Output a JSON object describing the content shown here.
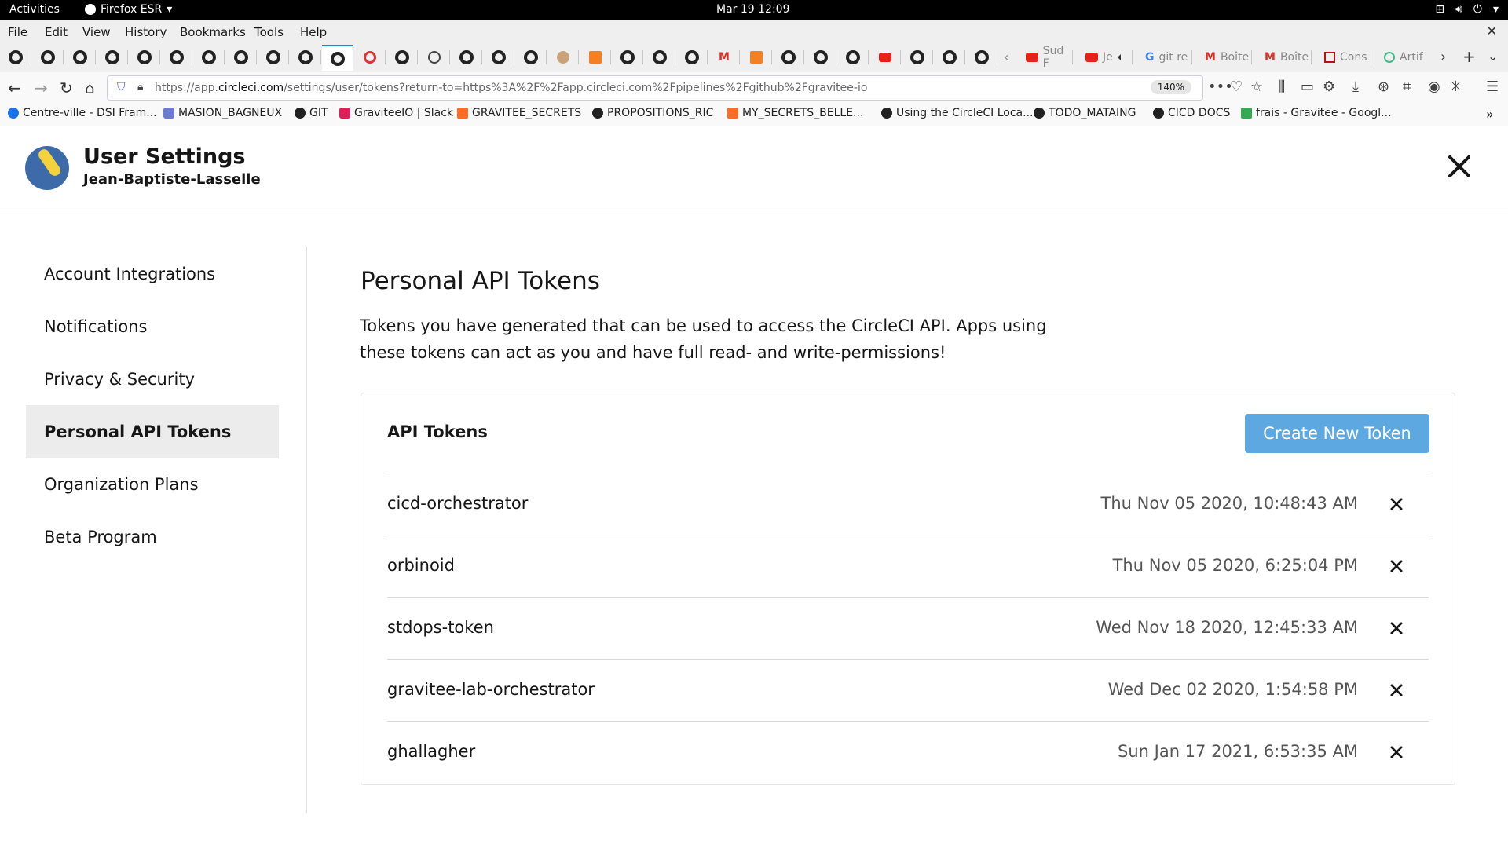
{
  "system_bar": {
    "activities": "Activities",
    "app_name": "Firefox ESR",
    "clock": "Mar 19  12:09"
  },
  "menu": [
    "File",
    "Edit",
    "View",
    "History",
    "Bookmarks",
    "Tools",
    "Help"
  ],
  "tabs_named": [
    "Sud F",
    "Je",
    "git re",
    "Boîte",
    "Boîte",
    "Cons",
    "Artif"
  ],
  "address_bar": {
    "url_prefix": "https://app.",
    "url_host": "circleci.com",
    "url_rest": "/settings/user/tokens?return-to=https%3A%2F%2Fapp.circleci.com%2Fpipelines%2Fgithub%2Fgravitee-io",
    "zoom": "140%"
  },
  "bookmarks": [
    "Centre-ville - DSI Fram...",
    "MASION_BAGNEUX",
    "GIT",
    "GraviteeIO | Slack",
    "GRAVITEE_SECRETS",
    "PROPOSITIONS_RIC",
    "MY_SECRETS_BELLE...",
    "Using the CircleCI Loca...",
    "TODO_MATAING",
    "CICD DOCS",
    "frais - Gravitee - Googl..."
  ],
  "header": {
    "title": "User Settings",
    "username": "Jean-Baptiste-Lasselle"
  },
  "sidebar": {
    "items": [
      {
        "label": "Account Integrations"
      },
      {
        "label": "Notifications"
      },
      {
        "label": "Privacy & Security"
      },
      {
        "label": "Personal API Tokens"
      },
      {
        "label": "Organization Plans"
      },
      {
        "label": "Beta Program"
      }
    ],
    "active": "Personal API Tokens"
  },
  "main": {
    "title": "Personal API Tokens",
    "description": "Tokens you have generated that can be used to access the CircleCI API. Apps using these tokens can act as you and have full read- and write-permissions!",
    "card_title": "API Tokens",
    "create_button": "Create New Token",
    "tokens": [
      {
        "name": "cicd-orchestrator",
        "date": "Thu Nov 05 2020, 10:48:43 AM"
      },
      {
        "name": "orbinoid",
        "date": "Thu Nov 05 2020, 6:25:04 PM"
      },
      {
        "name": "stdops-token",
        "date": "Wed Nov 18 2020, 12:45:33 AM"
      },
      {
        "name": "gravitee-lab-orchestrator",
        "date": "Wed Dec 02 2020, 1:54:58 PM"
      },
      {
        "name": "ghallagher",
        "date": "Sun Jan 17 2021, 6:53:35 AM"
      }
    ]
  },
  "colors": {
    "accent_button": "#5da8e0",
    "active_nav_bg": "#ececec"
  }
}
